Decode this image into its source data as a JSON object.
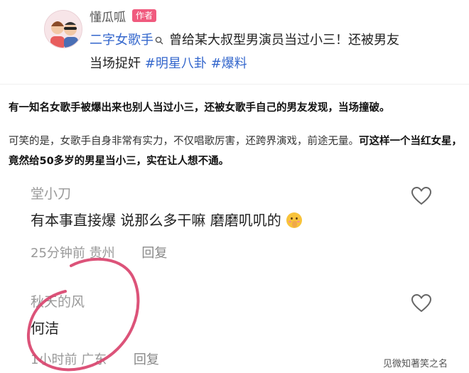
{
  "post": {
    "author": "懂瓜呱",
    "badge": "作者",
    "topic": "二字女歌手",
    "title_rest": "曾给某大叔型男演员当过小三！还被男友",
    "title_line2": "当场捉奸",
    "tags": [
      "#明星八卦",
      "#爆料"
    ]
  },
  "article": {
    "para1": "有一知名女歌手被爆出来也别人当过小三，还被女歌手自己的男友发现，当场撞破。",
    "para2_normal": "可笑的是，女歌手自身非常有实力，不仅唱歌厉害，还跨界演戏，前途无量。",
    "para2_bold": "可这样一个当红女星，竟然给50多岁的男星当小三，实在让人想不通。"
  },
  "comments": [
    {
      "name": "堂小刀",
      "text": "有本事直接爆  说那么多干嘛  磨磨叽叽的",
      "time": "25分钟前",
      "location": "贵州",
      "reply": "回复"
    },
    {
      "name": "秋天的风",
      "text": "何洁",
      "time": "1小时前",
      "location": "广东",
      "reply": "回复"
    }
  ],
  "watermark": "见微知著笑之名",
  "colors": {
    "badge": "#f05a7e",
    "link": "#3366cc",
    "annotation": "#d8406a"
  }
}
